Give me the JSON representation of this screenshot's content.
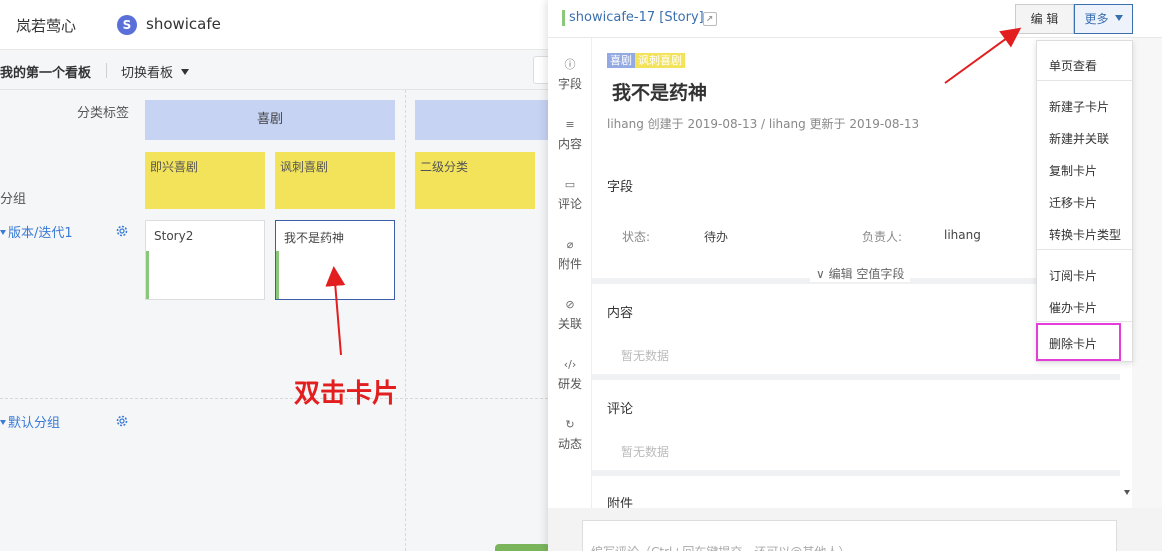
{
  "app": {
    "brand": "岚若莺心",
    "project_avatar_letter": "S",
    "project_name": "showicafe"
  },
  "board_bar": {
    "board_name": "我的第一个看板",
    "switch_board": "切换看板"
  },
  "board": {
    "category_label": "分类标签",
    "group_label": "分组",
    "lanes": [
      {
        "category": "喜剧",
        "subs": [
          "即兴喜剧",
          "讽刺喜剧"
        ]
      },
      {
        "category": "",
        "subs": [
          "二级分类"
        ]
      }
    ],
    "rows": [
      {
        "label": "版本/迭代1"
      },
      {
        "label": "默认分组"
      }
    ],
    "cards": [
      {
        "title": "Story2"
      },
      {
        "title": "我不是药神"
      }
    ],
    "hint": "双击卡片"
  },
  "panel": {
    "header_title": "showicafe-17 [Story]",
    "edit_button": "编 辑",
    "more_button": "更多",
    "nav": [
      "字段",
      "内容",
      "评论",
      "附件",
      "关联",
      "研发",
      "动态"
    ],
    "tags": [
      "喜剧",
      "讽刺喜剧"
    ],
    "card_title": "我不是药神",
    "meta": "lihang 创建于 2019-08-13  /  lihang 更新于 2019-08-13",
    "fields_title": "字段",
    "field_status_label": "状态:",
    "field_status_value": "待办",
    "field_owner_label": "负责人:",
    "field_owner_value": "lihang",
    "edit_empty_fields": "∨ 编辑 空值字段",
    "content_title": "内容",
    "content_empty": "暂无数据",
    "comment_title": "评论",
    "comment_empty": "暂无数据",
    "attachment_title": "附件",
    "comment_placeholder": "编写评论（Ctrl+回车键提交，还可以@其他人）"
  },
  "menu": {
    "group1": [
      "单页查看"
    ],
    "group2": [
      "新建子卡片",
      "新建并关联",
      "复制卡片",
      "迁移卡片",
      "转换卡片类型"
    ],
    "group3": [
      "订阅卡片",
      "催办卡片"
    ],
    "delete": "删除卡片"
  },
  "colors": {
    "category_blue": "#c6d3f3",
    "sub_yellow": "#f2e35b",
    "link_blue": "#3a7bd5",
    "annotation_red": "#e21e1e",
    "highlight_magenta": "#e53dd9"
  }
}
